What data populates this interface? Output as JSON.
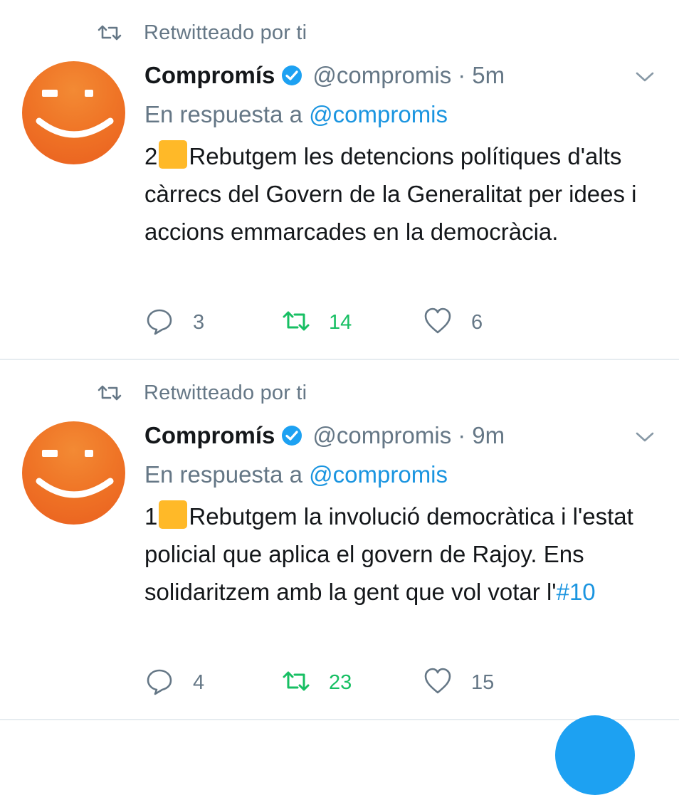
{
  "colors": {
    "accent": "#1b95e0",
    "retweet_active": "#17bf63",
    "muted": "#657786",
    "text": "#14171a",
    "emoji_square": "#ffb928",
    "avatar_orange": "#ef7426"
  },
  "tweets": [
    {
      "retweet_label": "Retwitteado por ti",
      "author_name": "Compromís",
      "handle": "@compromis",
      "separator": "·",
      "time": "5m",
      "reply_prefix": "En respuesta a",
      "reply_mention": "@compromis",
      "text_number": "2",
      "text_body": "Rebutgem les detencions polítiques d'alts càrrecs del Govern de la Generalitat per idees i accions emmarcades en la democràcia.",
      "hashtag": "",
      "replies": "3",
      "retweets": "14",
      "likes": "6"
    },
    {
      "retweet_label": "Retwitteado por ti",
      "author_name": "Compromís",
      "handle": "@compromis",
      "separator": "·",
      "time": "9m",
      "reply_prefix": "En respuesta a",
      "reply_mention": "@compromis",
      "text_number": "1",
      "text_body": "Rebutgem la involució democràtica i l'estat policial que aplica el govern de Rajoy. Ens solidaritzem amb la gent que vol votar l'",
      "hashtag": "#10",
      "replies": "4",
      "retweets": "23",
      "likes": "15"
    }
  ],
  "icons": {
    "retweet_indicator": "retweet-icon",
    "verified": "verified-badge-icon",
    "menu": "chevron-down-icon",
    "reply": "reply-icon",
    "retweet": "retweet-icon",
    "like": "heart-icon",
    "emoji": "yellow-square-emoji-icon",
    "compose": "compose-fab"
  }
}
